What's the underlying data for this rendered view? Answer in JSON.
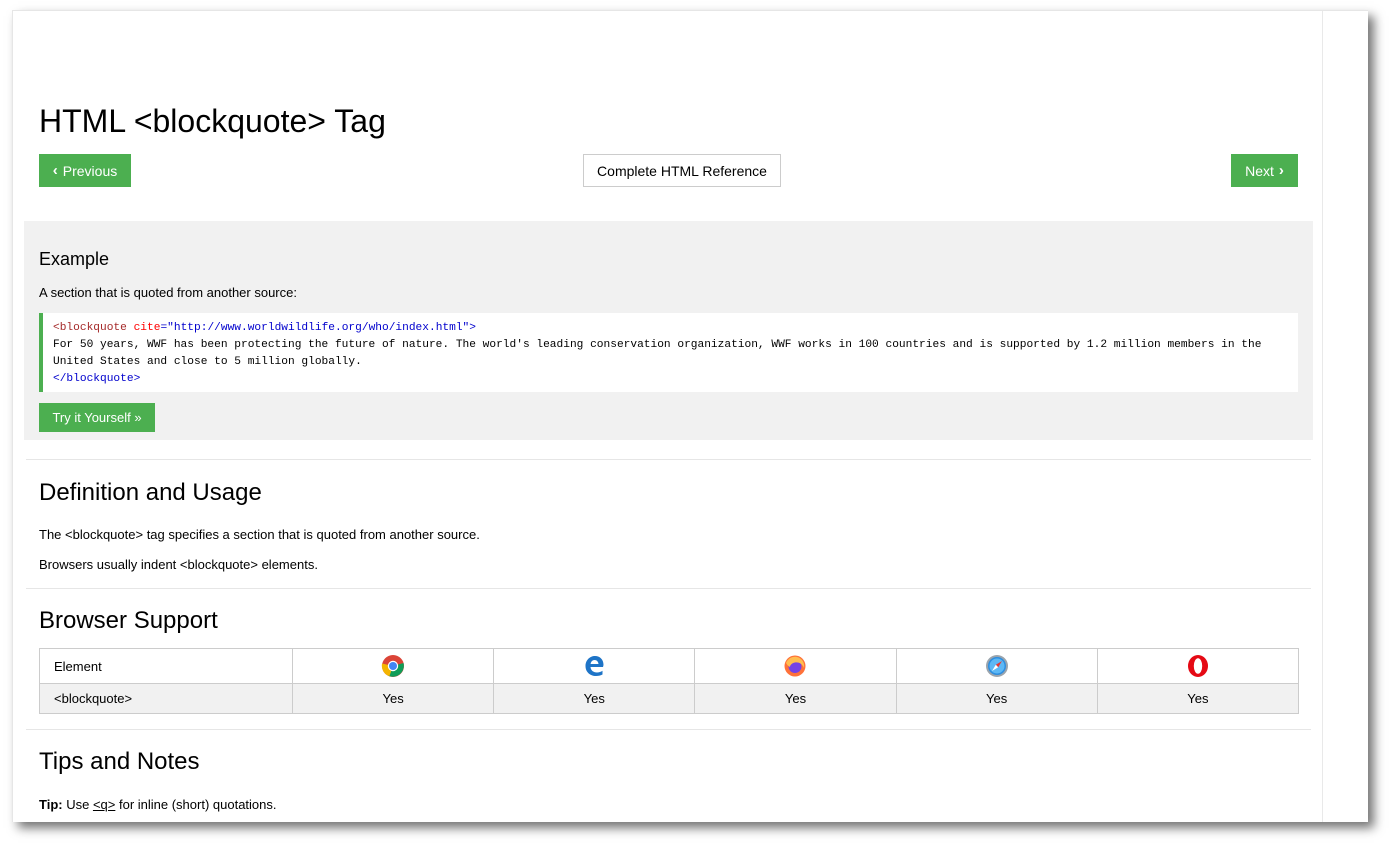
{
  "page": {
    "title": "HTML <blockquote> Tag"
  },
  "nav": {
    "previous_label": "Previous",
    "reference_label": "Complete HTML Reference",
    "next_label": "Next"
  },
  "example": {
    "heading": "Example",
    "intro": "A section that is quoted from another source:",
    "code": {
      "open_tag": "<blockquote",
      "attr_name": " cite",
      "equals": "=",
      "attr_value": "\"http://www.worldwildlife.org/who/index.html\"",
      "close_bracket": ">",
      "line1": "For 50 years, WWF has been protecting the future of nature. The world's leading conservation organization, WWF works in 100 countries and is supported by 1.2 million members in the",
      "line2": "United States and close to 5 million globally.",
      "end_tag": "</blockquote>"
    },
    "try_label": "Try it Yourself »"
  },
  "definition": {
    "heading": "Definition and Usage",
    "p1": "The <blockquote> tag specifies a section that is quoted from another source.",
    "p2": "Browsers usually indent <blockquote> elements."
  },
  "support": {
    "heading": "Browser Support",
    "header_label": "Element",
    "browsers": [
      {
        "icon": "chrome-icon"
      },
      {
        "icon": "edge-icon"
      },
      {
        "icon": "firefox-icon"
      },
      {
        "icon": "safari-icon"
      },
      {
        "icon": "opera-icon"
      }
    ],
    "row": {
      "element": "<blockquote>",
      "values": [
        "Yes",
        "Yes",
        "Yes",
        "Yes",
        "Yes"
      ]
    }
  },
  "tips": {
    "heading": "Tips and Notes",
    "tip_label": "Tip:",
    "tip_pre": " Use ",
    "tip_link": "<q>",
    "tip_post": " for inline (short) quotations."
  },
  "colors": {
    "accent_green": "#4caf50",
    "example_bg": "#f1f1f1"
  }
}
